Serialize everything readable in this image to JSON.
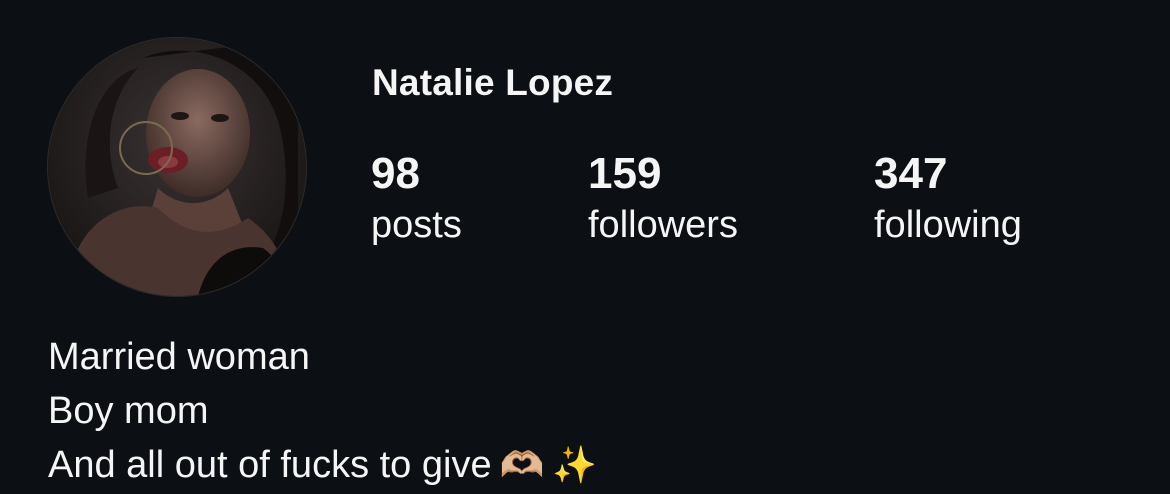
{
  "profile": {
    "name": "Natalie Lopez",
    "avatar_alt": "profile photo"
  },
  "stats": {
    "posts": {
      "count": "98",
      "label": "posts"
    },
    "followers": {
      "count": "159",
      "label": "followers"
    },
    "following": {
      "count": "347",
      "label": "following"
    }
  },
  "bio": {
    "line1": "Married woman",
    "line2": "Boy mom",
    "line3": "And all out of fucks to give",
    "emoji1": "🫶🏼",
    "emoji2": "✨"
  },
  "colors": {
    "background": "#0c0f14",
    "text": "#f5f5f5"
  }
}
